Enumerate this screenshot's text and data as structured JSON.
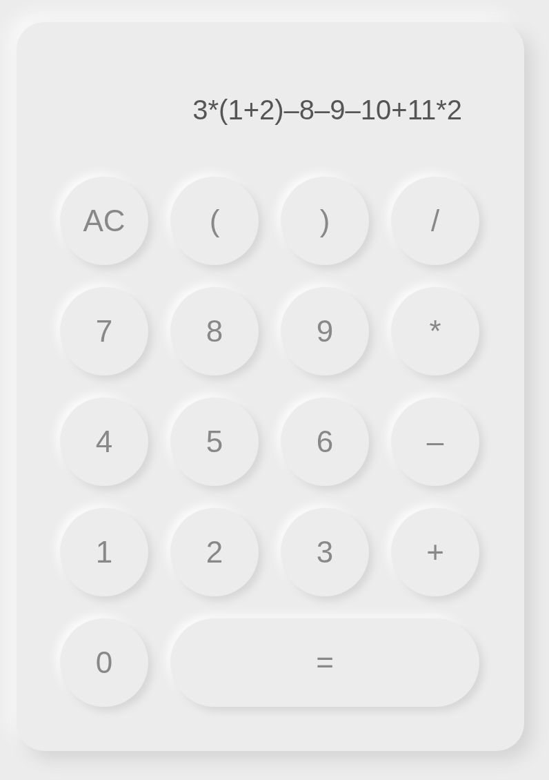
{
  "display": {
    "expression": "3*(1+2)–8–9–10+11*2"
  },
  "keys": [
    {
      "label": "AC",
      "kind": "round"
    },
    {
      "label": "(",
      "kind": "round"
    },
    {
      "label": ")",
      "kind": "round"
    },
    {
      "label": "/",
      "kind": "round"
    },
    {
      "label": "7",
      "kind": "round"
    },
    {
      "label": "8",
      "kind": "round"
    },
    {
      "label": "9",
      "kind": "round"
    },
    {
      "label": "*",
      "kind": "round"
    },
    {
      "label": "4",
      "kind": "round"
    },
    {
      "label": "5",
      "kind": "round"
    },
    {
      "label": "6",
      "kind": "round"
    },
    {
      "label": "–",
      "kind": "round"
    },
    {
      "label": "1",
      "kind": "round"
    },
    {
      "label": "2",
      "kind": "round"
    },
    {
      "label": "3",
      "kind": "round"
    },
    {
      "label": "+",
      "kind": "round"
    },
    {
      "label": "0",
      "kind": "round"
    },
    {
      "label": "=",
      "kind": "wide"
    }
  ]
}
